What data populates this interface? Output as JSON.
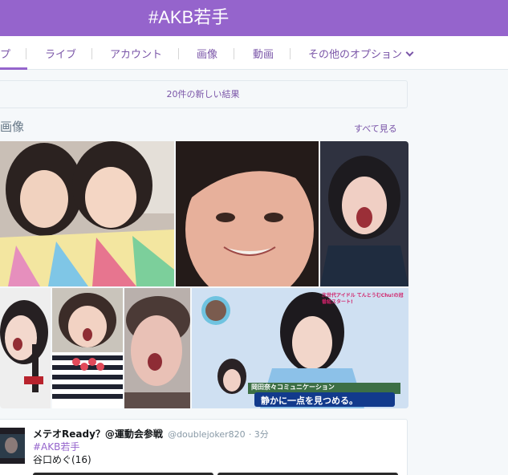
{
  "header": {
    "title": "#AKB若手"
  },
  "tabs": [
    {
      "label": "プ"
    },
    {
      "label": "ライブ"
    },
    {
      "label": "アカウント"
    },
    {
      "label": "画像"
    },
    {
      "label": "動画"
    },
    {
      "label": "その他のオプション"
    }
  ],
  "new_results": {
    "label": "20件の新しい結果"
  },
  "images_section": {
    "title": "画像",
    "see_all": "すべて見る",
    "tile_caption": "静かに一点を見つめる。",
    "tile_banner": "次世代アイドル てんとうむChu!の冠番組スタート!",
    "tile_subcaption": "岡田奈々コミュニケーション"
  },
  "tweet": {
    "name": "メテオReady？@運動会参戦",
    "handle": "@doublejoker820",
    "time": "· 3分",
    "hashtag": "#AKB若手",
    "text": "谷口めぐ(16)"
  },
  "colors": {
    "accent": "#9564cc",
    "link": "#7a55a8"
  }
}
